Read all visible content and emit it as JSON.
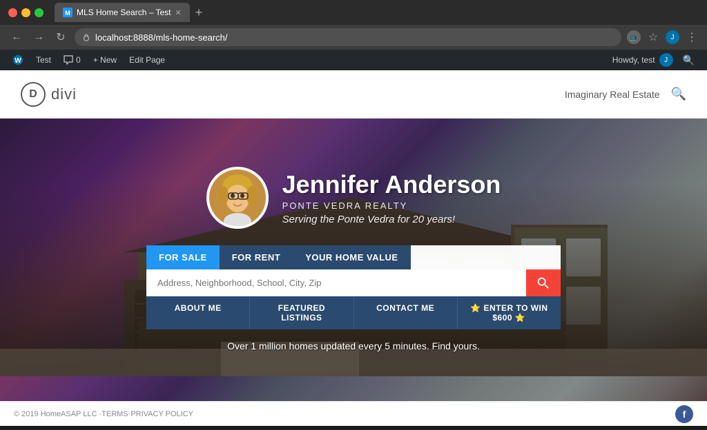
{
  "browser": {
    "tab_title": "MLS Home Search – Test",
    "address": "localhost:8888/mls-home-search/",
    "favicon_letter": "M"
  },
  "wp_admin_bar": {
    "wp_logo": "W",
    "test_label": "Test",
    "comments_label": "0",
    "new_label": "+ New",
    "edit_label": "Edit Page",
    "howdy_label": "Howdy, test",
    "user_initial": "J"
  },
  "site_header": {
    "logo_letter": "D",
    "logo_text": "divi",
    "nav_link": "Imaginary Real Estate"
  },
  "hero": {
    "agent_name": "Jennifer Anderson",
    "agent_company": "PONTE VEDRA REALTY",
    "agent_tagline": "Serving the Ponte Vedra for 20 years!",
    "search_tabs": [
      {
        "label": "FOR SALE",
        "active": true
      },
      {
        "label": "FOR RENT",
        "active": false
      },
      {
        "label": "YOUR HOME VALUE",
        "active": false
      }
    ],
    "search_placeholder": "Address, Neighborhood, School, City, Zip",
    "nav_links": [
      {
        "label": "ABOUT ME"
      },
      {
        "label": "FEATURED LISTINGS"
      },
      {
        "label": "CONTACT ME"
      },
      {
        "label": "⭐ ENTER TO WIN $600 ⭐"
      }
    ],
    "footer_text": "Over 1 million homes updated every 5 minutes. Find yours."
  },
  "site_footer": {
    "copyright": "© 2019 HomeASAP LLC · ",
    "terms_link": "TERMS",
    "separator": " · ",
    "privacy_link": "PRIVACY POLICY",
    "fb_letter": "f"
  }
}
